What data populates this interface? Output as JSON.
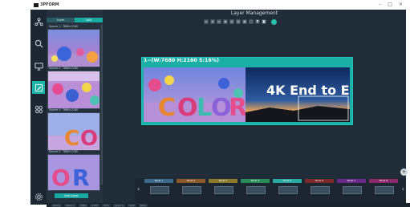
{
  "app": {
    "brand": "3PFORM",
    "window_controls": [
      "–",
      "□",
      "×"
    ]
  },
  "left_panel": {
    "tabs": [
      "Layer",
      "Split"
    ],
    "layers": [
      {
        "caption": "Source 1 · 7680×2160"
      },
      {
        "caption": "Source 2 · 7680×2160"
      },
      {
        "caption": "Source 3 · 7680×2160"
      },
      {
        "caption": "Source 4 · 7680×2160"
      }
    ],
    "add_button": "Add Layer"
  },
  "workspace": {
    "title": "Layer Management",
    "toolbar_icons": [
      "align-left",
      "align-center",
      "align-right",
      "align-top",
      "align-middle",
      "align-bottom",
      "distribute",
      "fit",
      "lock",
      "unlock"
    ],
    "screen_label": "1--(W:7680 H:2160 S:16%)",
    "overlay_text": "4K End to End"
  },
  "banks": {
    "items": [
      {
        "name": "Bank 1",
        "color": "#3b6a8a"
      },
      {
        "name": "Bank 2",
        "color": "#8a5a2a"
      },
      {
        "name": "Bank 3",
        "color": "#8a7a2a"
      },
      {
        "name": "Bank 4",
        "color": "#2a8a5a"
      },
      {
        "name": "Bank 5",
        "color": "#2aa9a0"
      },
      {
        "name": "Bank 6",
        "color": "#7a2a2a"
      },
      {
        "name": "Bank 7",
        "color": "#6a2a8a"
      },
      {
        "name": "Bank 8",
        "color": "#8a2a6a"
      }
    ],
    "prev": "‹",
    "next": "›"
  },
  "zoom_icon": "+",
  "status": [
    "Ready",
    "Bank 1",
    "7680",
    "2160",
    "16%",
    "Layer 1",
    "Split",
    "Save"
  ],
  "colors": {
    "accent": "#1ab0a6",
    "background": "#1e2a35"
  }
}
